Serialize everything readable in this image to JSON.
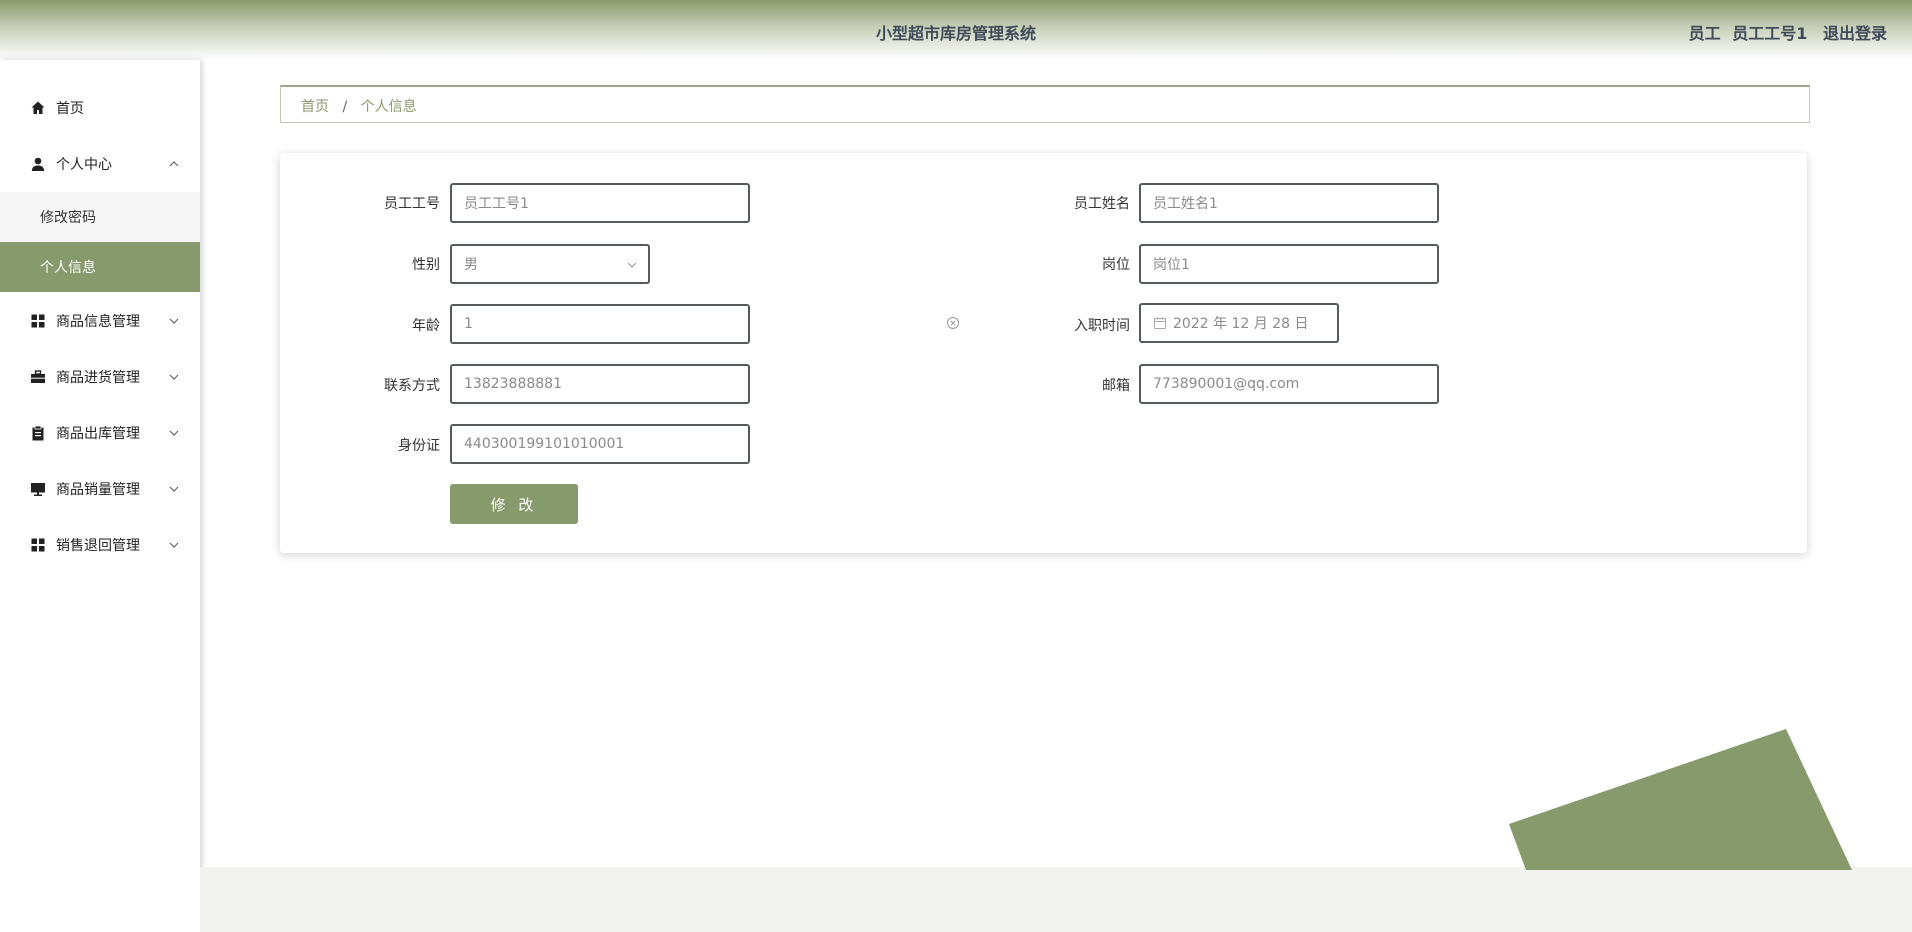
{
  "header": {
    "title": "小型超市库房管理系统",
    "role": "员工",
    "username": "员工工号1",
    "logout": "退出登录"
  },
  "sidebar": {
    "items": [
      {
        "label": "首页",
        "icon": "home-icon"
      },
      {
        "label": "个人中心",
        "icon": "user-icon",
        "expanded": true,
        "children": [
          {
            "label": "修改密码"
          },
          {
            "label": "个人信息",
            "active": true
          }
        ]
      },
      {
        "label": "商品信息管理",
        "icon": "grid-icon"
      },
      {
        "label": "商品进货管理",
        "icon": "briefcase-icon"
      },
      {
        "label": "商品出库管理",
        "icon": "clipboard-icon"
      },
      {
        "label": "商品销量管理",
        "icon": "monitor-icon"
      },
      {
        "label": "销售退回管理",
        "icon": "grid-icon"
      }
    ]
  },
  "breadcrumb": {
    "home": "首页",
    "separator": "/",
    "current": "个人信息"
  },
  "form": {
    "employee_id": {
      "label": "员工工号",
      "value": "员工工号1"
    },
    "employee_name": {
      "label": "员工姓名",
      "value": "员工姓名1"
    },
    "gender": {
      "label": "性别",
      "value": "男"
    },
    "position": {
      "label": "岗位",
      "value": "岗位1"
    },
    "age": {
      "label": "年龄",
      "value": "1"
    },
    "hire_date": {
      "label": "入职时间",
      "value": "2022 年 12 月 28 日"
    },
    "phone": {
      "label": "联系方式",
      "value": "13823888881"
    },
    "email": {
      "label": "邮箱",
      "value": "773890001@qq.com"
    },
    "id_card": {
      "label": "身份证",
      "value": "440300199101010001"
    },
    "submit_label": "修 改"
  },
  "colors": {
    "accent": "#879a6b",
    "header_text": "#3f4a59"
  }
}
